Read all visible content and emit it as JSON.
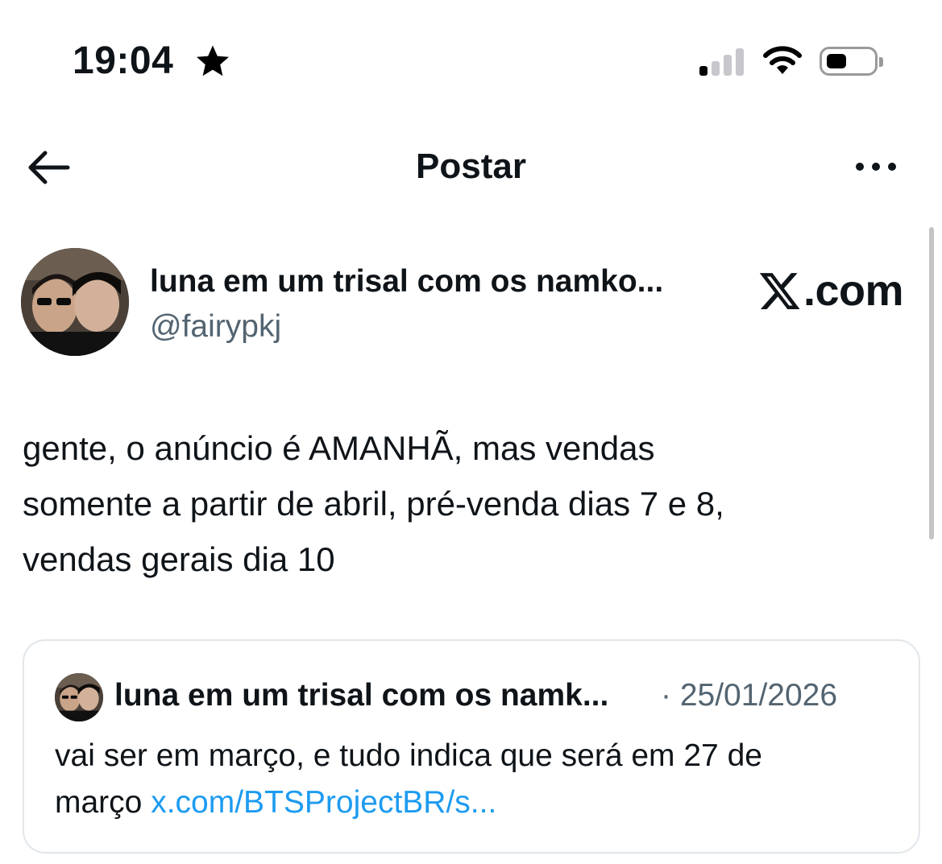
{
  "status_bar": {
    "time": "19:04",
    "icons": [
      "star-icon",
      "cellular-signal-icon",
      "wifi-icon",
      "battery-icon"
    ]
  },
  "header": {
    "title": "Postar",
    "back_icon": "arrow-left-icon",
    "more_icon": "more-horizontal-icon"
  },
  "post": {
    "author_name": "luna em um trisal com os namko...",
    "author_handle": "@fairypkj",
    "brand": ".com",
    "text_lines": [
      "gente, o anúncio é AMANHÃ, mas vendas",
      "somente a partir de abril, pré-venda dias 7 e 8,",
      "vendas gerais dia 10"
    ]
  },
  "quote": {
    "author_name": "luna em um trisal com os namk...",
    "separator": "·",
    "date": "25/01/2026",
    "text_line1": "vai ser em março, e tudo indica que será em 27 de",
    "text_line2_prefix": "março ",
    "link": "x.com/BTSProjectBR/s..."
  },
  "colors": {
    "text": "#0f1419",
    "secondary": "#536471",
    "link": "#1d9bf0",
    "border": "#e1e6ea"
  }
}
